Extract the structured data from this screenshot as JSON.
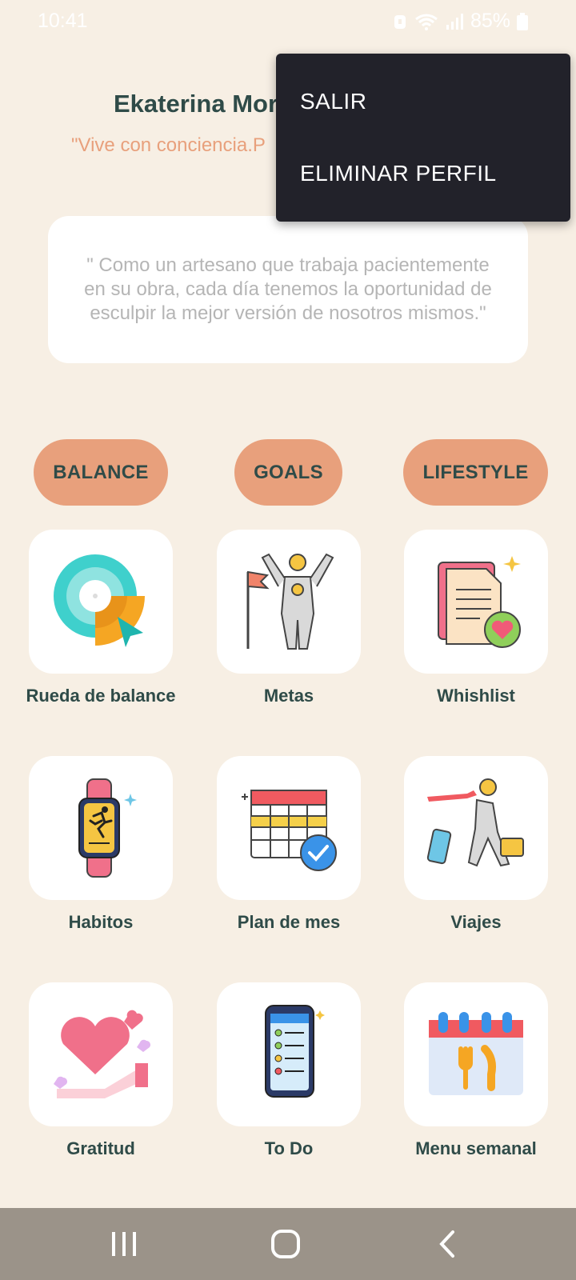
{
  "status": {
    "time": "10:41",
    "battery": "85%"
  },
  "profile": {
    "name": "Ekaterina Mor",
    "motto": "\"Vive con conciencia.P"
  },
  "quote": "\" Como un artesano que trabaja pacientemente en su obra, cada día tenemos la oportunidad de esculpir la mejor versión de nosotros mismos.\"",
  "menu": {
    "items": [
      {
        "label": "SALIR"
      },
      {
        "label": "ELIMINAR PERFIL"
      }
    ]
  },
  "categories": [
    {
      "label": "BALANCE"
    },
    {
      "label": "GOALS"
    },
    {
      "label": "LIFESTYLE"
    }
  ],
  "tiles": [
    {
      "label": "Rueda de balance",
      "icon": "balance-wheel-icon"
    },
    {
      "label": "Metas",
      "icon": "trophy-person-icon"
    },
    {
      "label": "Whishlist",
      "icon": "wishlist-icon"
    },
    {
      "label": "Habitos",
      "icon": "smartwatch-icon"
    },
    {
      "label": "Plan de mes",
      "icon": "calendar-check-icon"
    },
    {
      "label": "Viajes",
      "icon": "traveler-icon"
    },
    {
      "label": "Gratitud",
      "icon": "heart-hand-icon"
    },
    {
      "label": "To Do",
      "icon": "phone-checklist-icon"
    },
    {
      "label": "Menu semanal",
      "icon": "meal-calendar-icon"
    }
  ],
  "nav": {
    "recents": "recents-icon",
    "home": "home-icon",
    "back": "back-icon"
  }
}
